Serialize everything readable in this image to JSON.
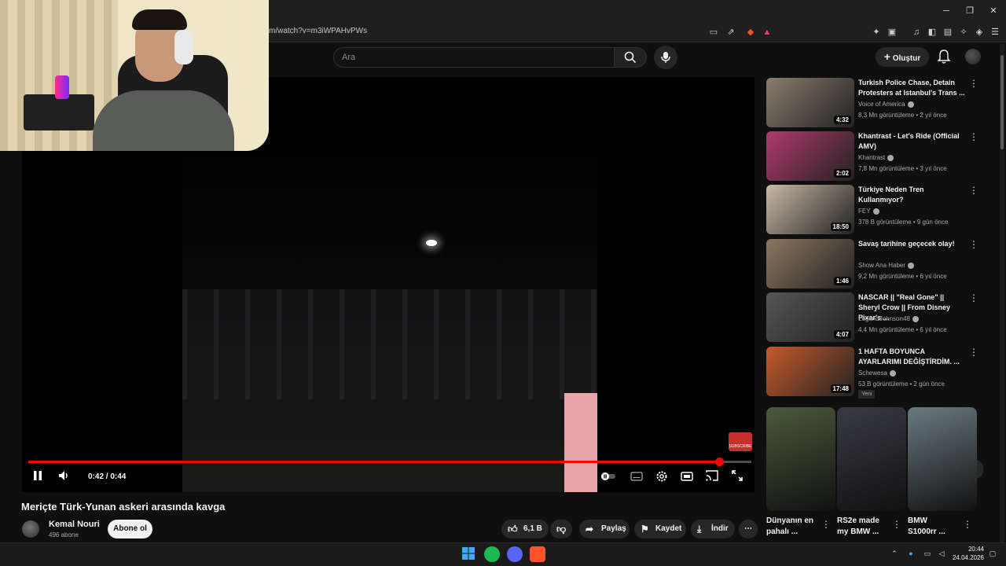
{
  "browser": {
    "url": "m/watch?v=m3iWPAHvPWs",
    "window_buttons": [
      "─",
      "❐",
      "✕"
    ]
  },
  "header": {
    "search_placeholder": "Ara",
    "create_label": "Oluştur",
    "plus": "+"
  },
  "player": {
    "time_display": "0:42 / 0:44",
    "progress": 0.955,
    "watermark": "SUBSCRIBE"
  },
  "video": {
    "title": "Meriçte Türk-Yunan askeri arasında kavga",
    "channel": "Kemal Nouri",
    "subscribers": "496 abone",
    "subscribe_label": "Abone ol",
    "likes": "6,1 B",
    "share_label": "Paylaş",
    "save_label": "Kaydet",
    "download_label": "İndir",
    "more": "⋯"
  },
  "recommendations": [
    {
      "title": "Turkish Police Chase, Detain Protesters at Istanbul's Trans ...",
      "channel": "Voice of America",
      "meta": "8,3 Mn görüntüleme • 2 yıl önce",
      "duration": "4:32",
      "color": "#8a7d6e"
    },
    {
      "title": "Khantrast - Let's Ride (Official AMV)",
      "channel": "Khantrast",
      "meta": "7,8 Mn görüntüleme • 3 yıl önce",
      "duration": "2:02",
      "color": "#b03a6a"
    },
    {
      "title": "Türkiye Neden Tren Kullanmıyor?",
      "channel": "FEY",
      "meta": "378 B görüntüleme • 9 gün önce",
      "duration": "18:50",
      "color": "#c9b9a6"
    },
    {
      "title": "Savaş tarihine geçecek olay!",
      "channel": "Show Ana Haber",
      "meta": "9,2 Mn görüntüleme • 6 yıl önce",
      "duration": "1:46",
      "color": "#8c7760"
    },
    {
      "title": "NASCAR || \"Real Gone\" || Sheryl Crow || From Disney Pixar's ...",
      "channel": "LegendJohnson48",
      "meta": "4,4 Mn görüntüleme • 6 yıl önce",
      "duration": "4:07",
      "color": "#565656"
    },
    {
      "title": "1 HAFTA BOYUNCA AYARLARIMI DEĞİŞTİRDİM. ...",
      "channel": "Schewesa",
      "meta": "53 B görüntüleme • 2 gün önce",
      "duration": "17:48",
      "color": "#c85a2a",
      "badge": "Yeni"
    }
  ],
  "shorts": [
    {
      "title": "Dünyanın en pahalı ...",
      "color": "#4a5a3a"
    },
    {
      "title": "RS2e made my BMW ...",
      "color": "#3a3a44"
    },
    {
      "title": "BMW S1000rr ...",
      "color": "#6a7a80"
    }
  ],
  "taskbar": {
    "time": "20:44",
    "date": "24.04.2026"
  }
}
